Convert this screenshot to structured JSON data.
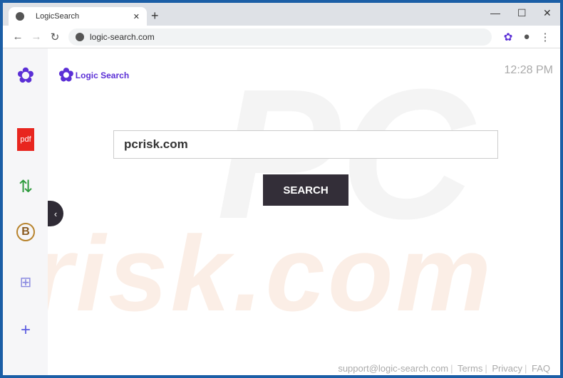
{
  "browser": {
    "tab_title": "LogicSearch",
    "url": "logic-search.com"
  },
  "page": {
    "brand": "Logic Search",
    "time": "12:28 PM",
    "search_value": "pcrisk.com",
    "search_button": "SEARCH",
    "watermark": "risk.com"
  },
  "sidebar": {
    "items": [
      {
        "icon": "pdf-icon",
        "label": "pdf"
      },
      {
        "icon": "convert-arrows-icon"
      },
      {
        "icon": "bitcoin-icon",
        "label": "B"
      },
      {
        "icon": "calculator-icon"
      },
      {
        "icon": "add-icon",
        "label": "+"
      }
    ]
  },
  "footer": {
    "links": [
      "support@logic-search.com",
      "Terms",
      "Privacy",
      "FAQ"
    ]
  },
  "colors": {
    "accent": "#5b2fd6",
    "button": "#332e38",
    "frame": "#1b5ea6"
  }
}
